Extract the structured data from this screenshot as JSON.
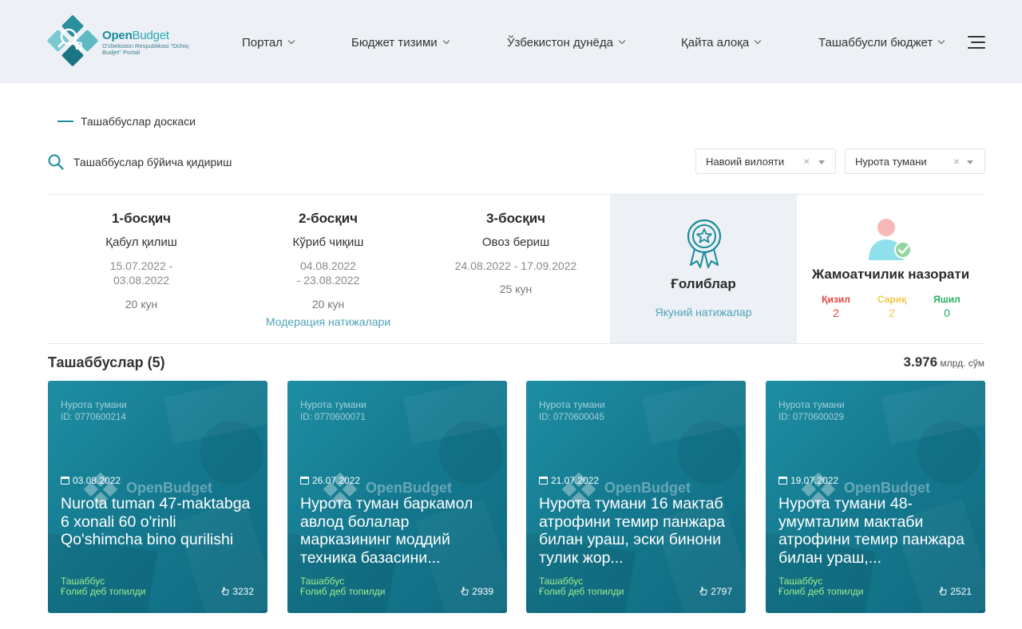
{
  "header": {
    "logo": {
      "title_a": "Open",
      "title_b": "Budget",
      "subtitle": "O'zbekiston Respublikasi \"Ochiq Budjet\" Portali"
    },
    "nav": [
      {
        "label": "Портал"
      },
      {
        "label": "Бюджет тизими"
      },
      {
        "label": "Ўзбекистон дунёда"
      },
      {
        "label": "Қайта алоқа"
      },
      {
        "label": "Ташаббусли бюджет"
      }
    ]
  },
  "breadcrumb": "Ташаббуслар доскаси",
  "search": {
    "placeholder": "Ташаббуслар бўйича қидириш"
  },
  "filters": {
    "region": "Навоий вилояти",
    "district": "Нурота тумани",
    "clear": "×"
  },
  "stages": [
    {
      "title": "1-босқич",
      "name": "Қабул қилиш",
      "dates": "15.07.2022 -\n03.08.2022",
      "days": "20 кун",
      "link": ""
    },
    {
      "title": "2-босқич",
      "name": "Кўриб чиқиш",
      "dates": "04.08.2022\n- 23.08.2022",
      "days": "20 кун",
      "link": "Модерация натижалари"
    },
    {
      "title": "3-босқич",
      "name": "Овоз бериш",
      "dates": "24.08.2022 - 17.09.2022",
      "days": "25 кун",
      "link": ""
    }
  ],
  "winners": {
    "title": "Ғолиблар",
    "link": "Якуний натижалар"
  },
  "control": {
    "title": "Жамоатчилик назорати",
    "columns": [
      {
        "label": "Қизил",
        "value": "2",
        "color": "#e8453c"
      },
      {
        "label": "Сариқ",
        "value": "2",
        "color": "#f2c94c"
      },
      {
        "label": "Яшил",
        "value": "0",
        "color": "#27ae60"
      }
    ]
  },
  "initiatives": {
    "title": "Ташаббуслар (5)",
    "total_value": "3.976",
    "total_unit": " млрд. сўм",
    "cards": [
      {
        "region": "Нурота тумани",
        "id": "ID: 0770600214",
        "date": "03.08.2022",
        "title": "Nurota tuman 47-maktabga 6 xonali 60 o'rinli Qo'shimcha bino qurilishi",
        "type": "Ташаббус",
        "status": "Ғолиб деб топилди",
        "votes": "3232"
      },
      {
        "region": "Нурота тумани",
        "id": "ID: 0770600071",
        "date": "26.07.2022",
        "title": "Нурота туман баркамол авлод болалар марказининг моддий техника базасини...",
        "type": "Ташаббус",
        "status": "Ғолиб деб топилди",
        "votes": "2939"
      },
      {
        "region": "Нурота тумани",
        "id": "ID: 0770600045",
        "date": "21.07.2022",
        "title": "Нурота тумани 16 мактаб атрофини темир панжара билан ураш, эски бинони тулик жор...",
        "type": "Ташаббус",
        "status": "Ғолиб деб топилди",
        "votes": "2797"
      },
      {
        "region": "Нурота тумани",
        "id": "ID: 0770600029",
        "date": "19.07.2022",
        "title": "Нурота тумани 48-умумталим мактаби атрофини темир панжара билан ураш,...",
        "type": "Ташаббус",
        "status": "Ғолиб деб топилди",
        "votes": "2521"
      }
    ]
  },
  "icons": {
    "logo": "open-budget-logo",
    "menu": "hamburger-menu-icon",
    "search": "search-icon",
    "medal": "medal-star-icon",
    "person": "person-check-icon",
    "calendar": "calendar-icon",
    "vote": "hand-vote-icon"
  },
  "colors": {
    "brand": "#1a8a9a",
    "link": "#4fa3b8",
    "header_bg": "#edf1f6",
    "card_bg": "#157a90",
    "status_green": "#9cf08a"
  }
}
